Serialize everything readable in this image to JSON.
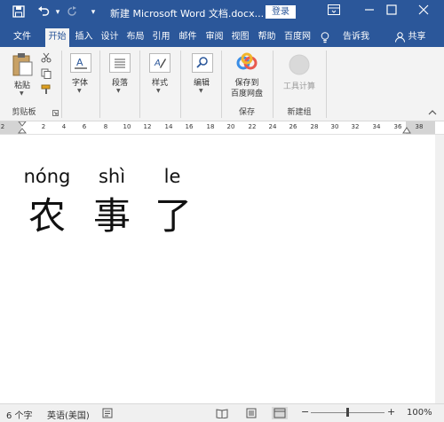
{
  "title_bar": {
    "title": "新建 Microsoft Word 文档.docx...",
    "login_label": "登录",
    "undo_dropdown": "▾",
    "customize_dropdown": "▾"
  },
  "tabs": [
    "文件",
    "开始",
    "插入",
    "设计",
    "布局",
    "引用",
    "邮件",
    "审阅",
    "视图",
    "帮助",
    "百度网",
    "告诉我",
    "共享"
  ],
  "ribbon": {
    "paste_label": "粘贴",
    "clipboard_label": "剪贴板",
    "font_label": "字体",
    "paragraph_label": "段落",
    "styles_label": "样式",
    "editing_label": "编辑",
    "save_to_baidu_line1": "保存到",
    "save_to_baidu_line2": "百度网盘",
    "save_group_label": "保存",
    "tool_calc_label": "工具计算",
    "new_group_label": "新建组"
  },
  "ruler": {
    "numbers": [
      "2",
      "2",
      "4",
      "6",
      "8",
      "10",
      "12",
      "14",
      "16",
      "18",
      "20",
      "22",
      "24",
      "26",
      "28",
      "30",
      "32",
      "34",
      "36",
      "38"
    ]
  },
  "document": {
    "pinyin": [
      "nóng",
      "shì",
      "le"
    ],
    "hanzi": [
      "农",
      "事",
      "了"
    ]
  },
  "status_bar": {
    "word_count": "6 个字",
    "language": "英语(美国)",
    "zoom": "100%",
    "zoom_minus": "−",
    "zoom_plus": "+"
  },
  "colors": {
    "accent": "#2b579a",
    "ribbon_bg": "#f3f3f3"
  }
}
